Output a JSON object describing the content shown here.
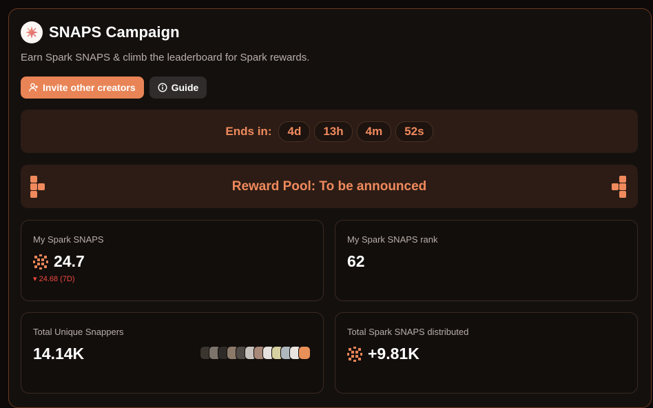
{
  "header": {
    "title": "SNAPS Campaign",
    "subtitle": "Earn Spark SNAPS & climb the leaderboard for Spark rewards."
  },
  "buttons": {
    "invite_label": "Invite other creators",
    "guide_label": "Guide"
  },
  "countdown": {
    "label": "Ends in:",
    "days": "4d",
    "hours": "13h",
    "minutes": "4m",
    "seconds": "52s"
  },
  "reward_pool": {
    "text": "Reward Pool: To be announced"
  },
  "stats": {
    "my_snaps": {
      "label": "My Spark SNAPS",
      "value": "24.7",
      "delta": "▾ 24.68 (7D)"
    },
    "my_rank": {
      "label": "My Spark SNAPS rank",
      "value": "62"
    },
    "unique_snappers": {
      "label": "Total Unique Snappers",
      "value": "14.14K"
    },
    "distributed": {
      "label": "Total Spark SNAPS distributed",
      "value": "+9.81K"
    }
  },
  "avatars": [
    {
      "color": "#3b3530"
    },
    {
      "color": "#7c746b"
    },
    {
      "color": "#2e2a27"
    },
    {
      "color": "#8b7a6a"
    },
    {
      "color": "#4f4a46"
    },
    {
      "color": "#c7c2bd"
    },
    {
      "color": "#a88878"
    },
    {
      "color": "#e6e1dc"
    },
    {
      "color": "#d7d0a0"
    },
    {
      "color": "#b0b8bf"
    },
    {
      "color": "#e9e4df"
    },
    {
      "color": "#e89058"
    }
  ],
  "colors": {
    "accent": "#f08a5d",
    "button_primary": "#e98456",
    "negative": "#f0483e"
  },
  "icons": {
    "logo": "spark-star-icon",
    "invite": "user-plus-icon",
    "guide": "info-circle-icon",
    "snaps": "snaps-burst-icon",
    "reward_deco": "pixel-arrow-icon"
  }
}
